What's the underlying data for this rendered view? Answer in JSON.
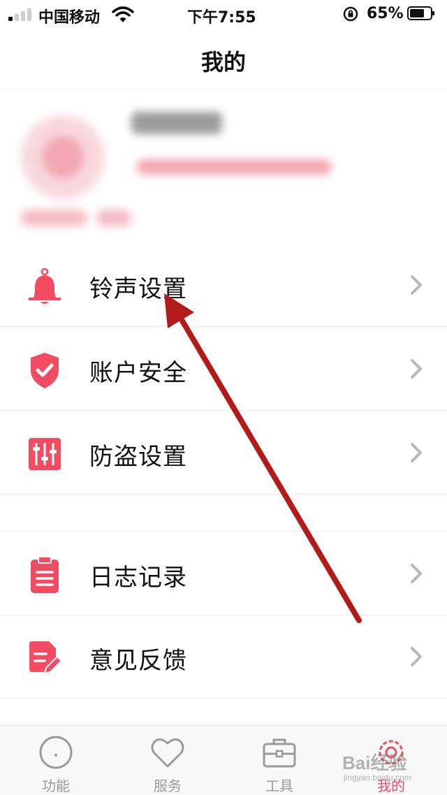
{
  "status_bar": {
    "carrier": "中国移动",
    "time": "下午7:55",
    "battery_percent": "65%",
    "signal_bars_active": 1,
    "signal_bars_total": 4
  },
  "header": {
    "title": "我的"
  },
  "menu": {
    "items": [
      {
        "label": "铃声设置",
        "icon": "bell-icon"
      },
      {
        "label": "账户安全",
        "icon": "shield-check-icon"
      },
      {
        "label": "防盗设置",
        "icon": "sliders-icon"
      },
      {
        "label": "日志记录",
        "icon": "clipboard-icon"
      },
      {
        "label": "意见反馈",
        "icon": "edit-document-icon"
      }
    ]
  },
  "tab_bar": {
    "tabs": [
      {
        "label": "功能",
        "icon": "circle-icon",
        "active": false
      },
      {
        "label": "服务",
        "icon": "heart-icon",
        "active": false
      },
      {
        "label": "工具",
        "icon": "toolbox-icon",
        "active": false
      },
      {
        "label": "我的",
        "icon": "gear-icon",
        "active": true
      }
    ]
  },
  "watermark": {
    "text": "Bai经验",
    "sub": "jingyan.baidu.com"
  },
  "colors": {
    "accent": "#f24b62",
    "annotation_arrow": "#b31b1b"
  }
}
